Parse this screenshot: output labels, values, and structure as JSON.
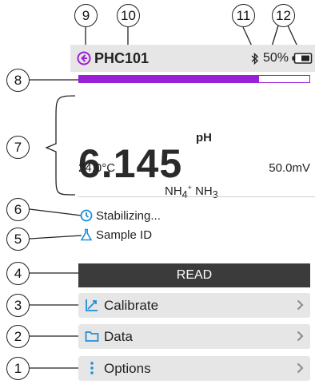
{
  "header": {
    "title": "PHC101",
    "battery_percent": "50%",
    "back_icon": "back-arrow-circle-icon",
    "bluetooth_icon": "bluetooth-icon",
    "battery_icon": "battery-icon"
  },
  "progress": {
    "fraction": 0.78
  },
  "measurement": {
    "value": "6.145",
    "unit": "pH",
    "temperature": "24.0°C",
    "millivolts": "50.0mV",
    "ion_a": "NH",
    "ion_a_sub": "4",
    "ion_a_sup": "+",
    "ion_b": "NH",
    "ion_b_sub": "3"
  },
  "status": {
    "stability_text": "Stabilizing...",
    "sample_id_text": "Sample ID"
  },
  "buttons": {
    "read": "READ",
    "calibrate": "Calibrate",
    "data": "Data",
    "options": "Options"
  },
  "callouts": [
    "1",
    "2",
    "3",
    "4",
    "5",
    "6",
    "7",
    "8",
    "9",
    "10",
    "11",
    "12"
  ],
  "colors": {
    "accent": "#9b1fd6",
    "blue_icon": "#1f8fd6",
    "header_bg": "#e6e6e6",
    "read_bg": "#3b3b3b"
  }
}
